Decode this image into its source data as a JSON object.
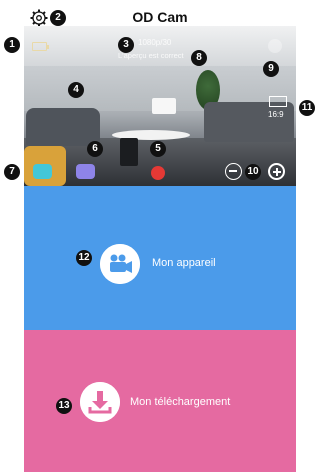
{
  "header": {
    "title": "OD Cam"
  },
  "camera": {
    "resolution": "1080p/30",
    "preview_text": "L'aperçu est correct",
    "aspect_ratio": "16:9"
  },
  "sections": {
    "device_label": "Mon appareil",
    "download_label": "Mon téléchargement"
  },
  "callouts": [
    "1",
    "2",
    "3",
    "4",
    "5",
    "6",
    "7",
    "8",
    "9",
    "10",
    "11",
    "12",
    "13"
  ],
  "colors": {
    "blue_section": "#4b9bea",
    "pink_section": "#e56aa1",
    "video_mode": "#43c7d8",
    "photo_mode": "#8e84e8",
    "record": "#e53935"
  },
  "icons": {
    "settings": "gear-icon",
    "battery": "battery-icon",
    "fullscreen": "fullscreen-icon",
    "aspect": "aspect-ratio-icon",
    "video_mode": "video-camera-icon",
    "photo_mode": "camera-icon",
    "record": "record-icon",
    "zoom_out": "zoom-out-icon",
    "zoom_in": "zoom-in-icon",
    "device": "video-camera-icon",
    "download": "download-icon"
  }
}
